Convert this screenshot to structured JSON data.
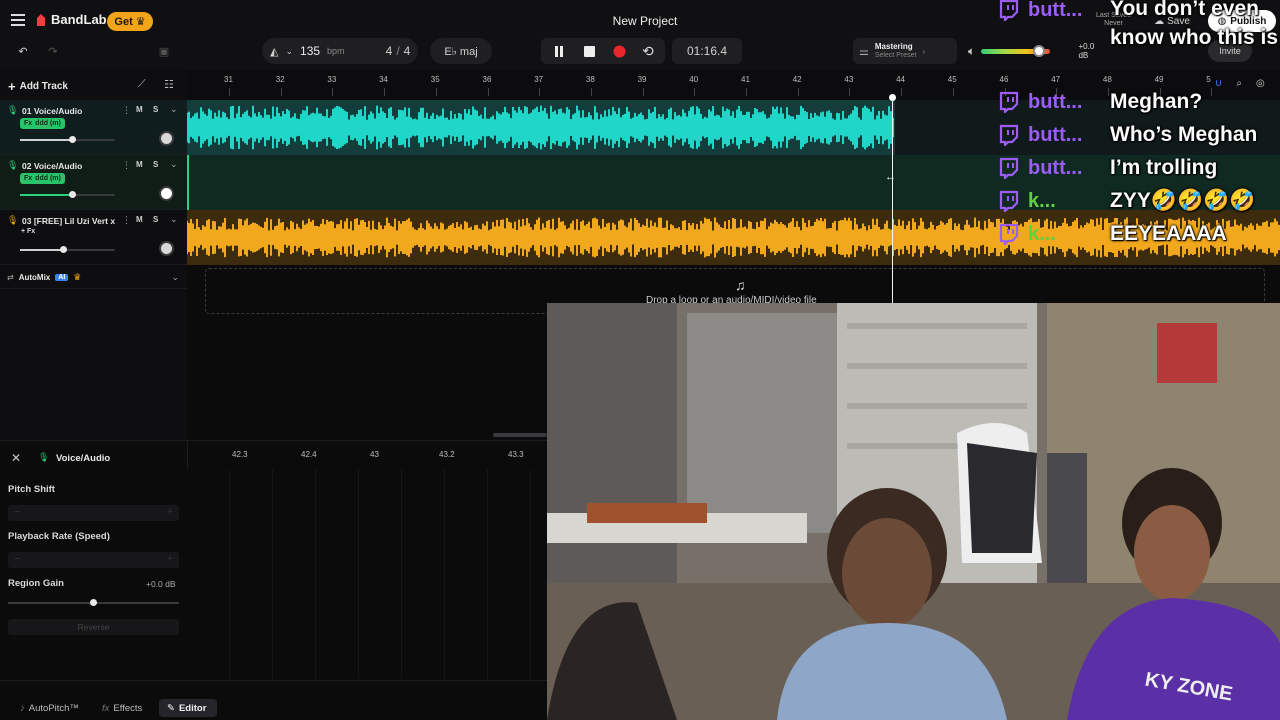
{
  "header": {
    "get_label": "Get",
    "project_title": "New Project",
    "tempo": "135",
    "tempo_unit": "bpm",
    "time_sig_num": "4",
    "time_sig_sep": "/",
    "time_sig_den": "4",
    "key": "E♭ maj",
    "time": "01:16.4",
    "mastering_label": "Mastering",
    "mastering_preset": "Select Preset",
    "volume_db": "+0.0 dB",
    "volume_level": 0.82,
    "last_saved_label": "Last Saved",
    "last_saved_value": "Never",
    "save_label": "Save",
    "publish_label": "Publish",
    "invite_label": "Invite"
  },
  "toolbar": {
    "add_track_label": "Add Track"
  },
  "tracks": [
    {
      "name": "01 Voice/Audio",
      "fx": "ddd (m)",
      "vol": 0.55,
      "color": "#1fd6c8"
    },
    {
      "name": "02 Voice/Audio",
      "fx": "ddd (m)",
      "vol": 0.55,
      "color": "#2bd07f"
    },
    {
      "name": "03 [FREE] Lil Uzi Vert x ...",
      "fx": "+ Fx",
      "vol": 0.45,
      "color": "#f2a81d"
    }
  ],
  "automix": {
    "label": "AutoMix",
    "badge": "AI"
  },
  "ruler": {
    "bars": [
      "31",
      "32",
      "33",
      "34",
      "35",
      "36",
      "37",
      "38",
      "39",
      "40",
      "41",
      "42",
      "43",
      "44",
      "45",
      "46",
      "47",
      "48",
      "49",
      "5"
    ]
  },
  "drop_zone": {
    "text": "Drop a loop or an audio/MIDI/video file"
  },
  "editor": {
    "title": "Voice/Audio",
    "pitch_shift_label": "Pitch Shift",
    "playback_rate_label": "Playback Rate (Speed)",
    "region_gain_label": "Region Gain",
    "region_gain_value": "+0.0 dB",
    "reverse_label": "Reverse",
    "ruler": [
      "42.3",
      "42.4",
      "43",
      "43.2",
      "43.3"
    ]
  },
  "bottom_tabs": {
    "autopitch": "AutoPitch™",
    "effects": "Effects",
    "editor": "Editor"
  },
  "chat": [
    {
      "user": "butt...",
      "message": "You don’t even know who this is",
      "user_color": "#9b5df5"
    },
    {
      "user": "butt...",
      "message": "Meghan?",
      "user_color": "#9b5df5"
    },
    {
      "user": "butt...",
      "message": "Who’s Meghan",
      "user_color": "#9b5df5"
    },
    {
      "user": "butt...",
      "message": "I’m trolling",
      "user_color": "#9b5df5"
    },
    {
      "user": "k...",
      "message": "ZYY🤣🤣🤣🤣",
      "user_color": "#5fd13f"
    },
    {
      "user": "k...",
      "message": "EEYEAAAA",
      "user_color": "#5fd13f"
    }
  ],
  "webcam": {
    "shirt_text": "KY ZONE"
  },
  "colors": {
    "accent": "#f3a51a",
    "record": "#e8262c",
    "track1": "#1fd6c8",
    "track3": "#f2a81d",
    "twitch": "#9b5df5"
  }
}
